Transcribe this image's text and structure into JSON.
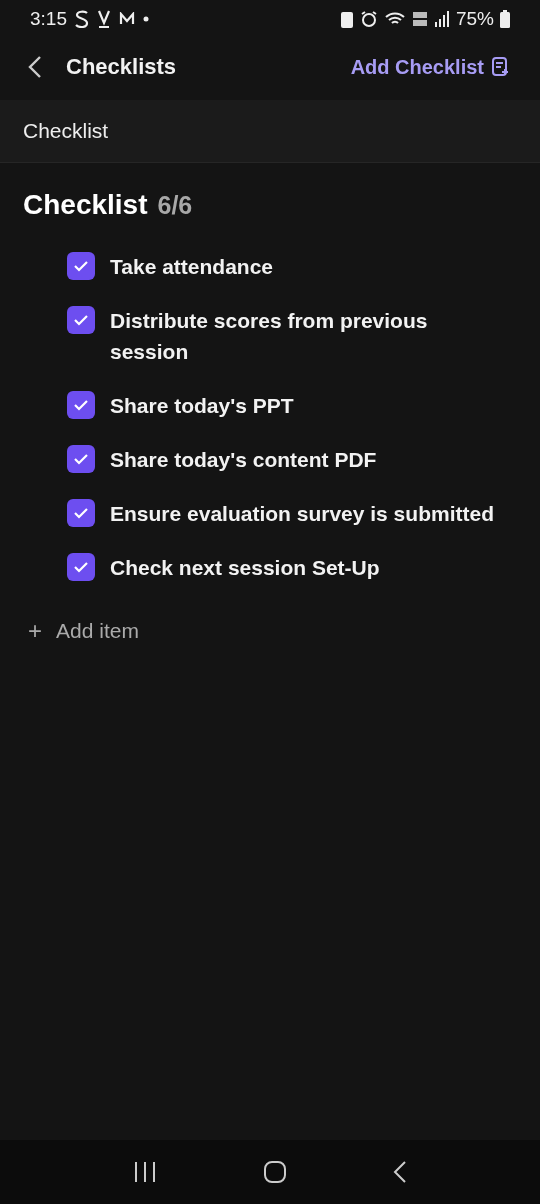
{
  "status_bar": {
    "time": "3:15",
    "battery": "75%"
  },
  "header": {
    "title": "Checklists",
    "action": "Add Checklist"
  },
  "section": {
    "label": "Checklist"
  },
  "checklist": {
    "title": "Checklist",
    "count": "6/6",
    "items": [
      {
        "text": "Take attendance",
        "checked": true
      },
      {
        "text": "Distribute scores from previous session",
        "checked": true
      },
      {
        "text": "Share today's PPT",
        "checked": true
      },
      {
        "text": "Share today's content PDF",
        "checked": true
      },
      {
        "text": "Ensure evaluation survey is submitted",
        "checked": true
      },
      {
        "text": "Check next session Set-Up",
        "checked": true
      }
    ],
    "add_item": {
      "symbol": "+",
      "label": "Add item"
    }
  }
}
